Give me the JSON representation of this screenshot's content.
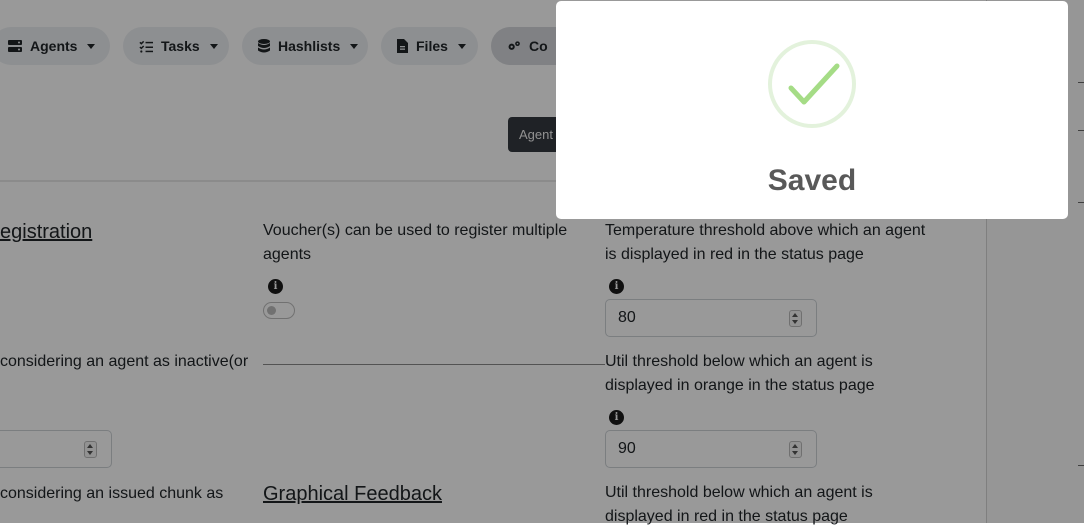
{
  "nav": {
    "items": [
      {
        "label": "Agents",
        "icon": "server-icon"
      },
      {
        "label": "Tasks",
        "icon": "tasks-list-icon"
      },
      {
        "label": "Hashlists",
        "icon": "database-icon"
      },
      {
        "label": "Files",
        "icon": "file-icon"
      },
      {
        "label": "Co",
        "icon": "cogs-icon"
      }
    ]
  },
  "tabs": {
    "active_label": "Agent"
  },
  "settings": {
    "registration_heading": "egistration",
    "voucher_text_line1": "Voucher(s) can be used to register multiple",
    "voucher_text_line2": "agents",
    "temp_text_line1": "Temperature threshold above which an agent",
    "temp_text_line2": "is displayed in red in the status page",
    "temp_value": "80",
    "inactive_text": "considering an agent as inactive(or",
    "util_orange_line1": "Util threshold below which an agent is",
    "util_orange_line2": "displayed in orange in the status page",
    "util_orange_value": "90",
    "chunk_text": "considering an issued chunk as",
    "graphical_heading": "Graphical Feedback",
    "util_red_line1": "Util threshold below which an agent is",
    "util_red_line2": "displayed in red in the status page"
  },
  "modal": {
    "title": "Saved",
    "icon": "check-icon",
    "check_color": "#a5dc86"
  },
  "colors": {
    "overlay": "rgba(0,0,0,0.4)",
    "dark_tab": "#343a40"
  }
}
